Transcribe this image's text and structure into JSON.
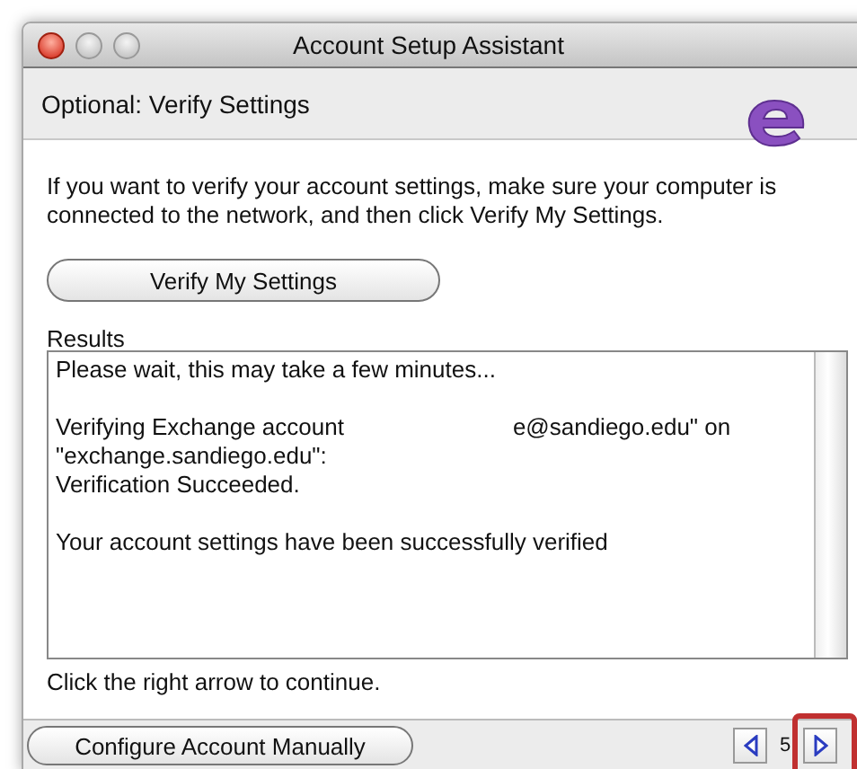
{
  "window": {
    "title": "Account Setup Assistant"
  },
  "header": {
    "title": "Optional: Verify Settings"
  },
  "intro": "If you want to verify your account settings, make sure your computer is connected to the network, and then click Verify My Settings.",
  "verify_button": "Verify My Settings",
  "results": {
    "label": "Results",
    "blocks": [
      [
        {
          "texts": [
            "Please wait, this may take a few minutes..."
          ]
        }
      ],
      [
        {
          "texts": [
            "Verifying Exchange account",
            "e@sandiego.edu\" on"
          ]
        },
        {
          "texts": [
            "\"exchange.sandiego.edu\":"
          ]
        },
        {
          "texts": [
            "Verification Succeeded."
          ]
        }
      ],
      [
        {
          "texts": [
            "Your account settings have been successfully verified"
          ]
        }
      ]
    ]
  },
  "hint": "Click the right arrow to continue.",
  "footer": {
    "configure_button": "Configure Account Manually",
    "page": "5",
    "next_highlighted": true
  }
}
